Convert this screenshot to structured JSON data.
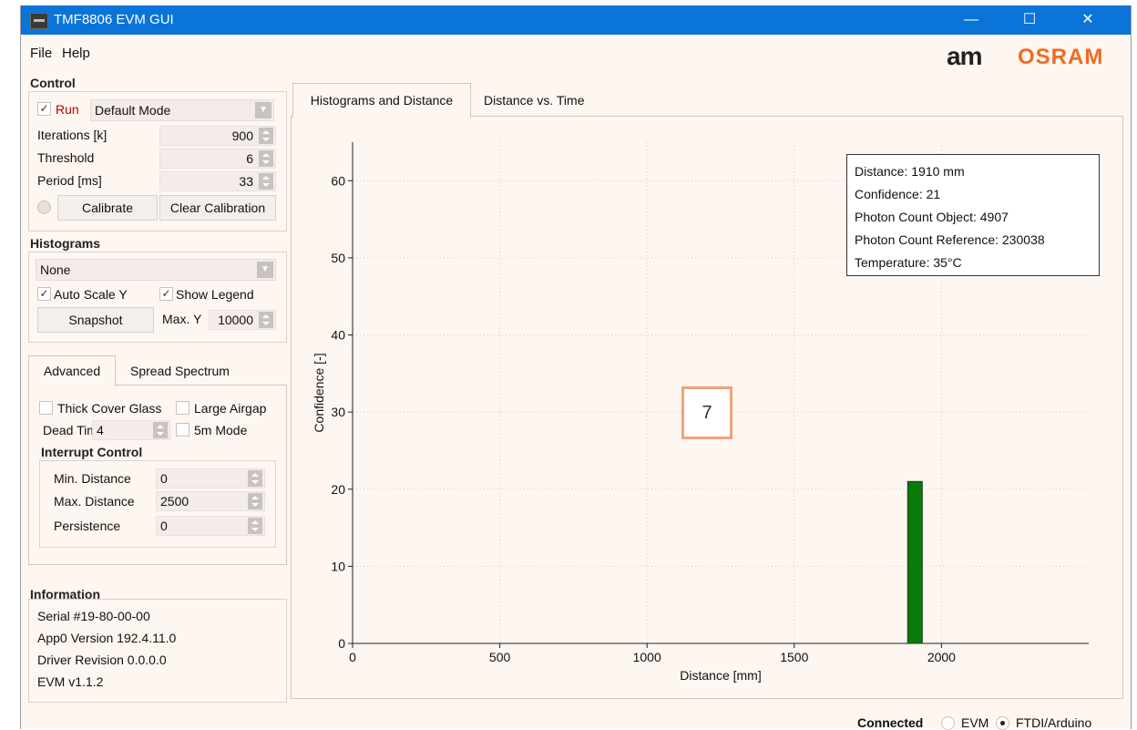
{
  "window": {
    "title": "TMF8806 EVM GUI",
    "minimize": "—",
    "maximize": "☐",
    "close": "✕"
  },
  "menu": {
    "file": "File",
    "help": "Help"
  },
  "logo": {
    "am": "am",
    "osram": "OSRAM"
  },
  "control": {
    "title": "Control",
    "run_label": "Run",
    "mode": "Default Mode",
    "iterations_label": "Iterations [k]",
    "iterations_value": "900",
    "threshold_label": "Threshold",
    "threshold_value": "6",
    "period_label": "Period [ms]",
    "period_value": "33",
    "calibrate": "Calibrate",
    "clear_calibration": "Clear Calibration"
  },
  "histograms": {
    "title": "Histograms",
    "selection": "None",
    "auto_scale": "Auto Scale Y",
    "show_legend": "Show Legend",
    "snapshot": "Snapshot",
    "max_y_label": "Max. Y",
    "max_y_value": "10000"
  },
  "advanced": {
    "tab_advanced": "Advanced",
    "tab_spread": "Spread Spectrum",
    "thick_cover": "Thick Cover Glass",
    "large_airgap": "Large Airgap",
    "dead_time_label": "Dead Time",
    "dead_time_value": "4",
    "five_m_mode": "5m Mode",
    "interrupt_title": "Interrupt Control",
    "min_distance_label": "Min. Distance",
    "min_distance_value": "0",
    "max_distance_label": "Max. Distance",
    "max_distance_value": "2500",
    "persistence_label": "Persistence",
    "persistence_value": "0"
  },
  "information": {
    "title": "Information",
    "serial": "Serial #19-80-00-00",
    "app_version": "App0 Version 192.4.11.0",
    "driver": "Driver Revision 0.0.0.0",
    "evm": "EVM v1.1.2"
  },
  "tabs": {
    "hist": "Histograms and Distance",
    "dvt": "Distance vs. Time"
  },
  "info_box": {
    "distance": "Distance: 1910 mm",
    "confidence": "Confidence: 21",
    "photon_object": "Photon Count Object: 4907",
    "photon_reference": "Photon Count Reference: 230038",
    "temperature": "Temperature: 35°C"
  },
  "annotation": "7",
  "status": {
    "connected": "Connected",
    "evm": "EVM",
    "ftdi": "FTDI/Arduino"
  },
  "colors": {
    "titlebar": "#0a74d8",
    "bar": "#0a7a0a",
    "accent": "#f26a21",
    "run": "#c00000"
  },
  "chart_data": {
    "type": "bar",
    "xlabel": "Distance [mm]",
    "ylabel": "Confidence [-]",
    "xlim": [
      0,
      2500
    ],
    "ylim": [
      0,
      65
    ],
    "x_ticks": [
      "0",
      "500",
      "1000",
      "1500",
      "2000"
    ],
    "y_ticks": [
      "0",
      "10",
      "20",
      "30",
      "40",
      "50",
      "60"
    ],
    "grid": true,
    "bars": [
      {
        "x": 1910,
        "value": 21
      }
    ]
  }
}
